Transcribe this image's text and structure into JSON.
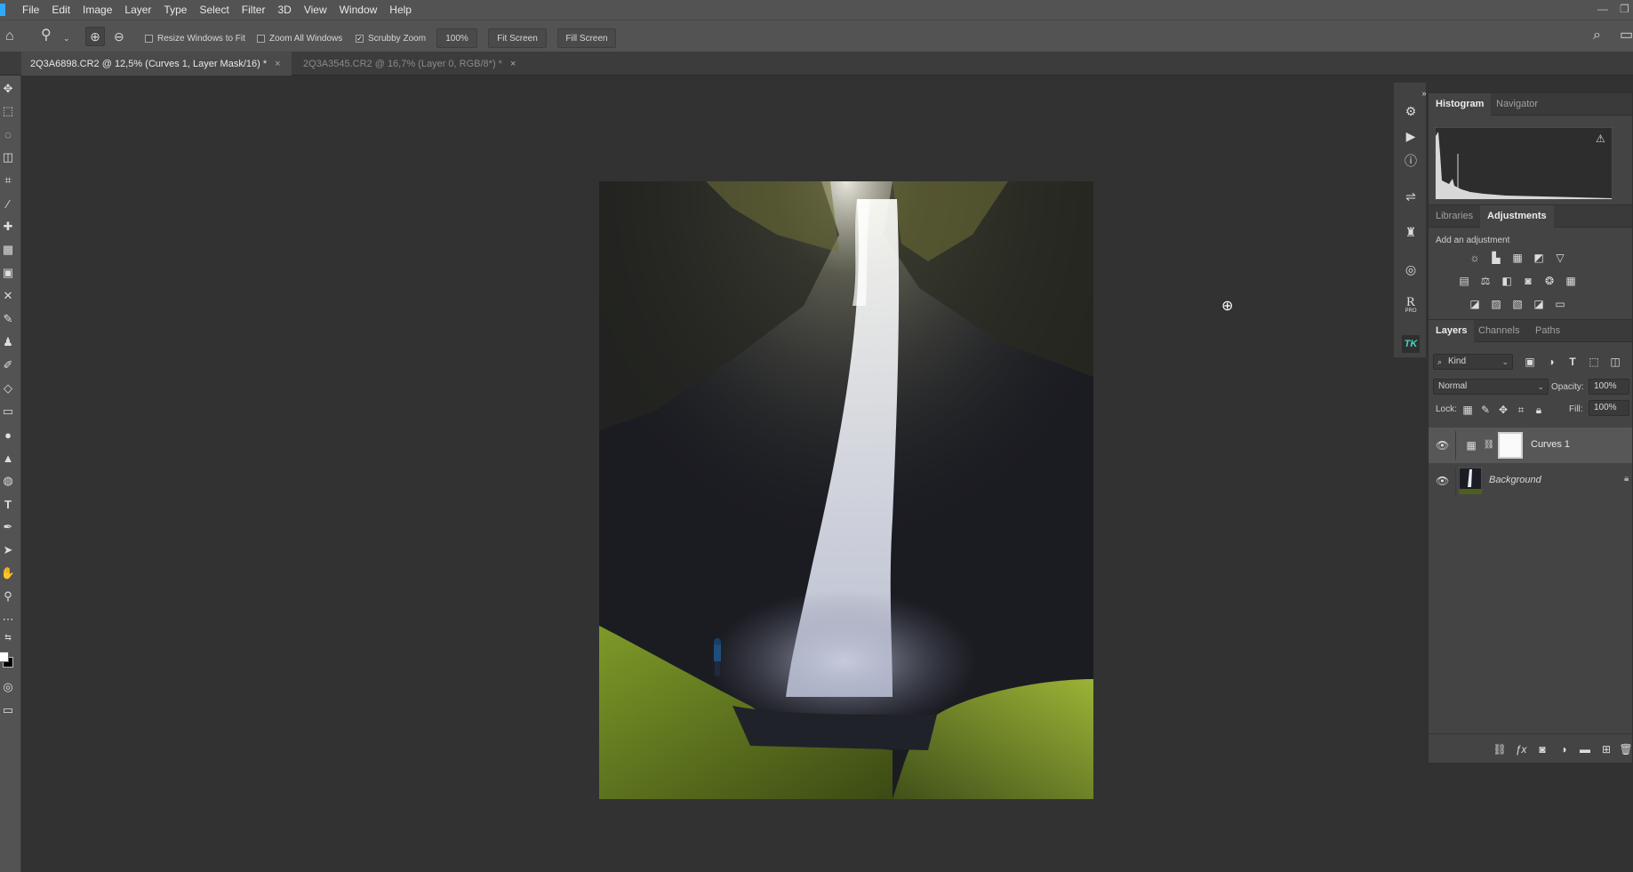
{
  "menubar": {
    "items": [
      "File",
      "Edit",
      "Image",
      "Layer",
      "Type",
      "Select",
      "Filter",
      "3D",
      "View",
      "Window",
      "Help"
    ]
  },
  "options": {
    "resize_windows": "Resize Windows to Fit",
    "zoom_all": "Zoom All Windows",
    "scrubby_zoom": "Scrubby Zoom",
    "zoom_level": "100%",
    "fit_screen": "Fit Screen",
    "fill_screen": "Fill Screen"
  },
  "tabs": [
    {
      "label": "2Q3A6898.CR2 @ 12,5% (Curves 1, Layer Mask/16) *",
      "active": true
    },
    {
      "label": "2Q3A3545.CR2 @ 16,7% (Layer 0, RGB/8*) *",
      "active": false
    }
  ],
  "panels": {
    "top_tabs": [
      "Histogram",
      "Navigator"
    ],
    "mid_tabs": [
      "Libraries",
      "Adjustments"
    ],
    "adjustments_hint": "Add an adjustment",
    "layers_tabs": [
      "Layers",
      "Channels",
      "Paths"
    ],
    "filter_kind": "Kind",
    "blend_mode": "Normal",
    "opacity_label": "Opacity:",
    "opacity_value": "100%",
    "lock_label": "Lock:",
    "fill_label": "Fill:",
    "fill_value": "100%"
  },
  "layers": [
    {
      "name": "Curves 1",
      "selected": true
    },
    {
      "name": "Background",
      "selected": false
    }
  ],
  "dock_icons": [
    "libraries-icon",
    "play-icon",
    "info-icon",
    "properties-icon",
    "stamp-icon",
    "target-icon",
    "raya-pro-icon",
    "tk-panel-icon"
  ],
  "dock_labels": {
    "raya": "R",
    "raya_sub": "PRO",
    "tk": "TK"
  },
  "colors": {
    "accent": "#31a8ff",
    "panel": "#444444",
    "app_bg": "#323232"
  }
}
